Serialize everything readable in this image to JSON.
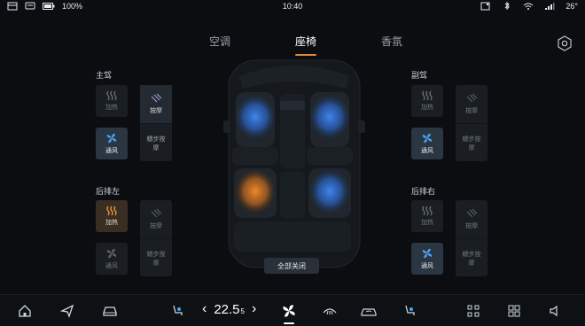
{
  "status": {
    "battery": "100%",
    "time": "10:40",
    "temp": "26°"
  },
  "tabs": [
    "空调",
    "座椅",
    "香氛"
  ],
  "active_tab": 1,
  "groups": {
    "driver": {
      "title": "主驾",
      "heat": "加热",
      "vent": "通风",
      "massage": "按摩",
      "step_massage": "蠕步按摩"
    },
    "passenger": {
      "title": "副驾",
      "heat": "加热",
      "vent": "通风",
      "massage": "按摩",
      "step_massage": "蠕步按摩"
    },
    "rear_left": {
      "title": "后排左",
      "heat": "加热",
      "vent": "通风",
      "massage": "按摩",
      "step_massage": "蠕步按摩"
    },
    "rear_right": {
      "title": "后排右",
      "heat": "加热",
      "vent": "通风",
      "massage": "按摩",
      "step_massage": "蠕步按摩"
    }
  },
  "all_off": "全部关闭",
  "bottom": {
    "temperature": "22.5",
    "temp_unit": "5"
  },
  "colors": {
    "accent": "#d98a38",
    "vent_blue": "#3a7bd5",
    "heat_orange": "#e58a2e"
  },
  "icons": {
    "home": "home-icon",
    "nav": "navigation-icon",
    "car": "car-icon",
    "seat": "seat-icon",
    "fan": "fan-icon",
    "defrost": "defrost-icon",
    "recirculate": "recirculate-icon",
    "seat_heat": "seat-heat-icon",
    "apps": "apps-icon",
    "grid": "grid-icon",
    "volume": "volume-icon",
    "settings": "gear-icon"
  }
}
